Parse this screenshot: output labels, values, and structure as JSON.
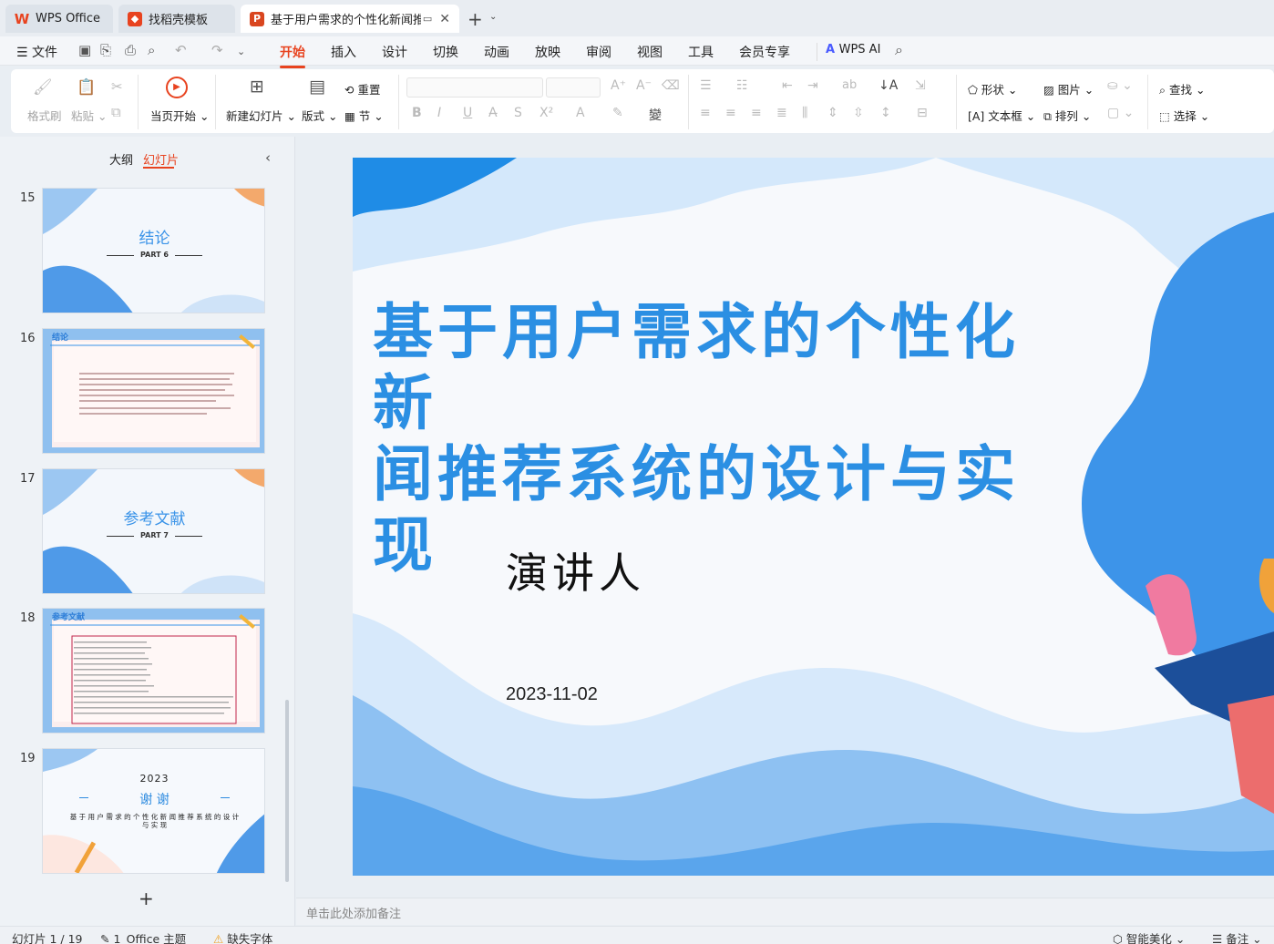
{
  "tabs": [
    {
      "label": "WPS Office",
      "icon": "wps-logo-icon"
    },
    {
      "label": "找稻壳模板",
      "icon": "docer-icon"
    },
    {
      "label": "基于用户需求的个性化新闻推荐",
      "icon": "ppt-file-icon"
    }
  ],
  "tab_add": "+",
  "file_menu": "文件",
  "menus": [
    "开始",
    "插入",
    "设计",
    "切换",
    "动画",
    "放映",
    "审阅",
    "视图",
    "工具",
    "会员专享"
  ],
  "wps_ai": "WPS AI",
  "ribbon": {
    "format_brush": "格式刷",
    "paste": "粘贴",
    "play_from_current": "当页开始",
    "new_slide": "新建幻灯片",
    "layout": "版式",
    "reset": "重置",
    "section": "节",
    "shape": "形状",
    "picture": "图片",
    "find": "查找",
    "textbox": "文本框",
    "arrange": "排列",
    "select": "选择"
  },
  "left_panel": {
    "tab_outline": "大纲",
    "tab_slides": "幻灯片",
    "add_slide": "+",
    "slides": [
      {
        "num": "15",
        "title": "结论",
        "sub": "PART 6"
      },
      {
        "num": "16",
        "title": "结论"
      },
      {
        "num": "17",
        "title": "参考文献",
        "sub": "PART 7"
      },
      {
        "num": "18",
        "title": "参考文献"
      },
      {
        "num": "19",
        "year": "2023",
        "title": "谢 谢",
        "sub": "基 于 用 户 需 求 的 个 性 化 新 闻 推 荐 系 统 的 设 计 与 实 现"
      }
    ]
  },
  "slide": {
    "title_line1": "基于用户需求的个性化新",
    "title_line2": "闻推荐系统的设计与实现",
    "presenter": "演讲人",
    "date": "2023-11-02"
  },
  "notes_placeholder": "单击此处添加备注",
  "status": {
    "slide_counter": "幻灯片 1 / 19",
    "theme": "1_Office 主题",
    "missing_font": "缺失字体",
    "smart_beautify": "智能美化",
    "notes": "备注"
  },
  "colors": {
    "accent": "#e8431f",
    "title_blue": "#2b8fe3",
    "slide_blue": "#3a93e8"
  }
}
